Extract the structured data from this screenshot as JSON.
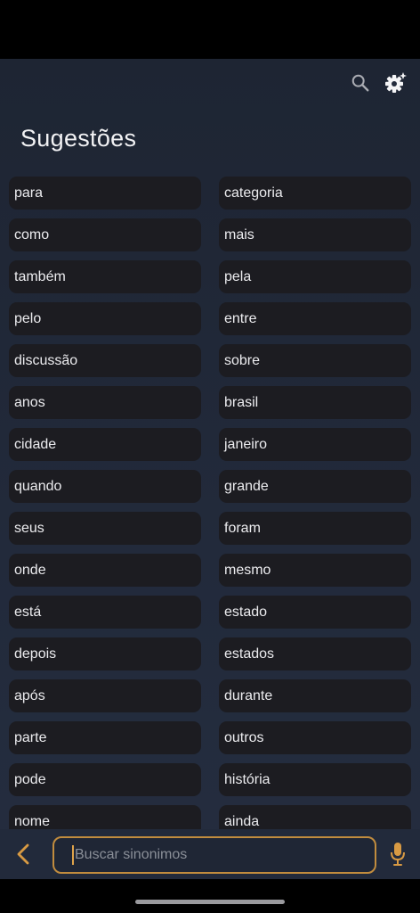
{
  "header": {
    "search_icon": "search-icon",
    "settings_icon": "settings-gear-icon"
  },
  "page": {
    "title": "Sugestões"
  },
  "suggestions": [
    "para",
    "categoria",
    "como",
    "mais",
    "também",
    "pela",
    "pelo",
    "entre",
    "discussão",
    "sobre",
    "anos",
    "brasil",
    "cidade",
    "janeiro",
    "quando",
    "grande",
    "seus",
    "foram",
    "onde",
    "mesmo",
    "está",
    "estado",
    "depois",
    "estados",
    "após",
    "durante",
    "parte",
    "outros",
    "pode",
    "história",
    "nome",
    "ainda"
  ],
  "bottom_bar": {
    "back_icon": "chevron-left-icon",
    "search_placeholder": "Buscar sinonimos",
    "search_value": "",
    "mic_icon": "microphone-icon"
  },
  "colors": {
    "accent": "#c18c3e",
    "chip_bg": "#1c1c21",
    "background": "#222a3b"
  }
}
